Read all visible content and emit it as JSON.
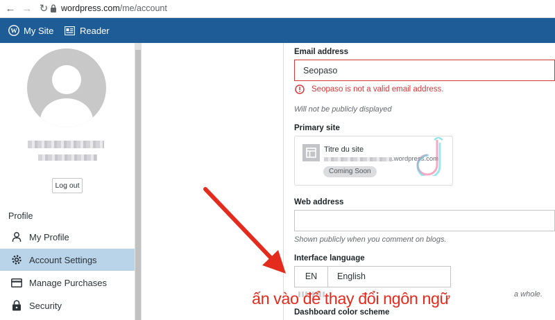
{
  "browser": {
    "url_host": "wordpress.com",
    "url_path": "/me/account"
  },
  "masterbar": {
    "my_site": "My Site",
    "reader": "Reader"
  },
  "sidebar": {
    "logout": "Log out",
    "section_title": "Profile",
    "items": [
      {
        "label": "My Profile",
        "icon": "user-icon"
      },
      {
        "label": "Account Settings",
        "icon": "gear-icon",
        "active": true
      },
      {
        "label": "Manage Purchases",
        "icon": "credit-card-icon"
      },
      {
        "label": "Security",
        "icon": "lock-icon"
      }
    ]
  },
  "account": {
    "email_label": "Email address",
    "email_value": "Seopaso",
    "email_error": "Seopaso is not a valid email address.",
    "email_hint": "Will not be publicly displayed",
    "primary_site_label": "Primary site",
    "site_title": "Titre du site",
    "site_url": ".wordpress.com",
    "site_badge": "Coming Soon",
    "web_address_label": "Web address",
    "web_address_value": "",
    "web_address_hint": "Shown publicly when you comment on blogs.",
    "language_label": "Interface language",
    "language_code": "EN",
    "language_name": "English",
    "language_hint_tail": "a whole.",
    "color_scheme_label": "Dashboard color scheme"
  },
  "annotation": {
    "text": "ấn vào để thay đổi ngôn ngữ",
    "color": "#e32b1e"
  },
  "colors": {
    "masterbar": "#1e5c97",
    "active_menu": "#b9d3e8",
    "error": "#d63638"
  }
}
